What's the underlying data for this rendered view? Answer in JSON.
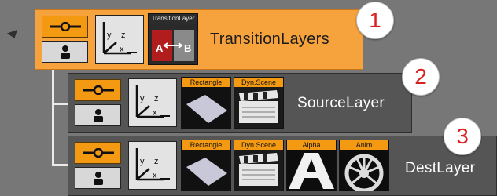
{
  "layers": {
    "root": {
      "name": "TransitionLayers",
      "thumbnail_label": "TransitionLayer",
      "callout": "1"
    },
    "source": {
      "name": "SourceLayer",
      "thumbnails": [
        "Rectangle",
        "Dyn.Scene"
      ],
      "callout": "2"
    },
    "dest": {
      "name": "DestLayer",
      "thumbnails": [
        "Rectangle",
        "Dyn.Scene",
        "Alpha",
        "Anim"
      ],
      "callout": "3"
    }
  },
  "transform_icon_axes": {
    "y": "y",
    "z": "z",
    "x": "x"
  },
  "icons": {
    "visibility": "eye-icon",
    "lock": "person-icon",
    "expand": "expand-arrow-icon"
  },
  "colors": {
    "root_fill": "#f6a33d",
    "child_fill": "#555555",
    "toggle_orange": "#f39a12",
    "callout_text": "#d92020"
  }
}
